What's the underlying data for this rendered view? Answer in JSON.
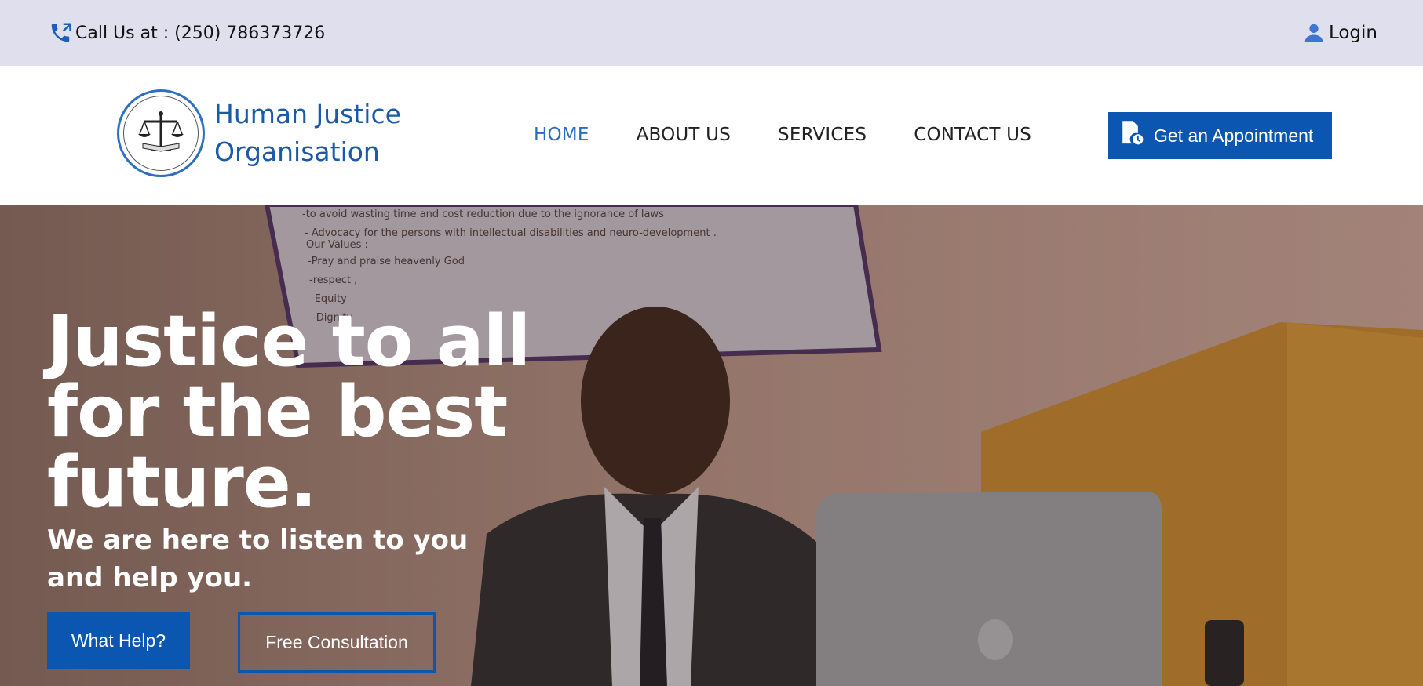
{
  "topbar": {
    "phone_label": "Call Us at : (250) 786373726",
    "phone_icon": "phone-forward-icon",
    "login_label": "Login",
    "login_icon": "user-icon"
  },
  "header": {
    "brand_name": "Human Justice Organisation",
    "nav": [
      {
        "label": "HOME",
        "active": true
      },
      {
        "label": "ABOUT US",
        "active": false
      },
      {
        "label": "SERVICES",
        "active": false
      },
      {
        "label": "CONTACT US",
        "active": false
      }
    ],
    "cta_label": "Get an Appointment",
    "cta_icon": "document-clock-icon"
  },
  "hero": {
    "title": "Justice to all for the best future.",
    "subtitle": "We are here to listen to you and help you.",
    "primary_button": "What Help?",
    "secondary_button": "Free Consultation"
  },
  "colors": {
    "brand_blue": "#0a56b0",
    "nav_active": "#2a6cc4",
    "topbar_bg": "#dfdfed"
  }
}
